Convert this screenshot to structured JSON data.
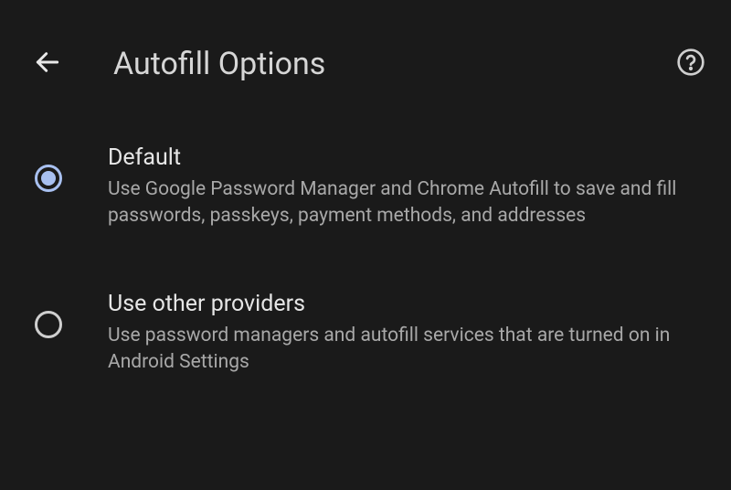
{
  "header": {
    "title": "Autofill Options"
  },
  "options": [
    {
      "title": "Default",
      "description": "Use Google Password Manager and Chrome Autofill to save and fill passwords, passkeys, payment methods, and addresses",
      "selected": true
    },
    {
      "title": "Use other providers",
      "description": "Use password managers and autofill services that are turned on in Android Settings",
      "selected": false
    }
  ],
  "colors": {
    "accent": "#a8c0f0",
    "background": "#1a1a1a"
  }
}
